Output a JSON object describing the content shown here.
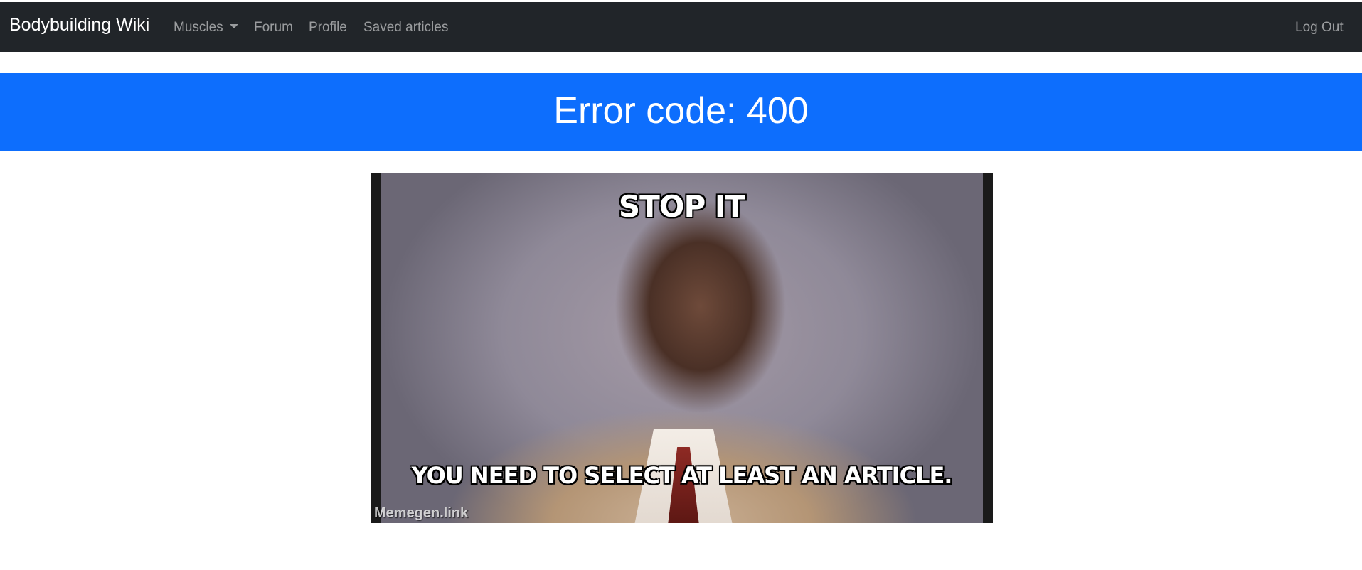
{
  "navbar": {
    "brand": "Bodybuilding Wiki",
    "items": [
      {
        "label": "Muscles"
      },
      {
        "label": "Forum"
      },
      {
        "label": "Profile"
      },
      {
        "label": "Saved articles"
      }
    ],
    "logout": "Log Out",
    "background": "#212529"
  },
  "banner": {
    "title": "Error code: 400",
    "background": "#0d6efd"
  },
  "meme": {
    "top_text": "STOP IT",
    "bottom_text": "YOU NEED TO SELECT AT LEAST AN ARTICLE.",
    "watermark": "Memegen.link"
  }
}
